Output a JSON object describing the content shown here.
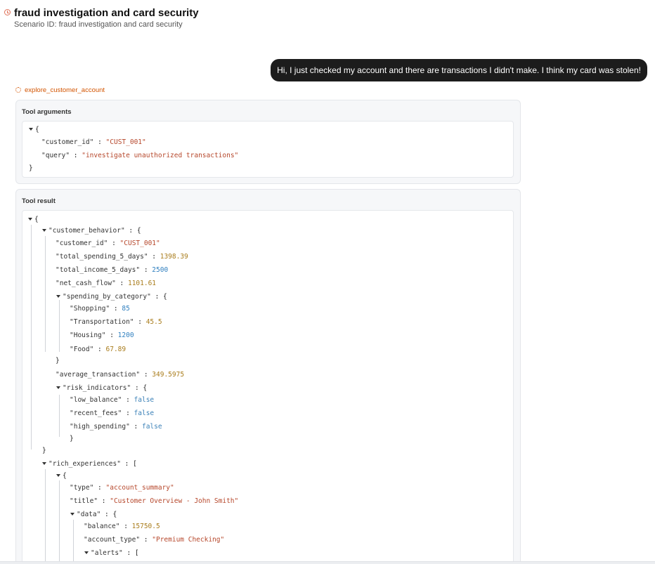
{
  "header": {
    "title": "fraud investigation and card security",
    "subtitle": "Scenario ID: fraud investigation and card security",
    "icon": "clock-icon"
  },
  "user_message": "Hi, I just checked my account and there are transactions I didn't make. I think my card was stolen!",
  "tool_call": {
    "name": "explore_customer_account",
    "icon": "gear-icon"
  },
  "tool_arguments": {
    "label": "Tool arguments",
    "customer_id_key": "\"customer_id\"",
    "customer_id": "\"CUST_001\"",
    "query_key": "\"query\"",
    "query": "\"investigate unauthorized transactions\""
  },
  "tool_result": {
    "label": "Tool result",
    "customer_behavior": {
      "key": "\"customer_behavior\"",
      "customer_id": {
        "key": "\"customer_id\"",
        "value": "\"CUST_001\""
      },
      "total_spending_5_days": {
        "key": "\"total_spending_5_days\"",
        "value": "1398.39"
      },
      "total_income_5_days": {
        "key": "\"total_income_5_days\"",
        "value": "2500"
      },
      "net_cash_flow": {
        "key": "\"net_cash_flow\"",
        "value": "1101.61"
      },
      "spending_by_category": {
        "key": "\"spending_by_category\"",
        "shopping": {
          "key": "\"Shopping\"",
          "value": "85"
        },
        "transportation": {
          "key": "\"Transportation\"",
          "value": "45.5"
        },
        "housing": {
          "key": "\"Housing\"",
          "value": "1200"
        },
        "food": {
          "key": "\"Food\"",
          "value": "67.89"
        }
      },
      "average_transaction": {
        "key": "\"average_transaction\"",
        "value": "349.5975"
      },
      "risk_indicators": {
        "key": "\"risk_indicators\"",
        "low_balance": {
          "key": "\"low_balance\"",
          "value": "false"
        },
        "recent_fees": {
          "key": "\"recent_fees\"",
          "value": "false"
        },
        "high_spending": {
          "key": "\"high_spending\"",
          "value": "false"
        }
      }
    },
    "rich_experiences": {
      "key": "\"rich_experiences\"",
      "type": {
        "key": "\"type\"",
        "value": "\"account_summary\""
      },
      "title": {
        "key": "\"title\"",
        "value": "\"Customer Overview - John Smith\""
      },
      "data": {
        "key": "\"data\"",
        "balance": {
          "key": "\"balance\"",
          "value": "15750.5"
        },
        "account_type": {
          "key": "\"account_type\"",
          "value": "\"Premium Checking\""
        },
        "alerts": {
          "key": "\"alerts\""
        }
      }
    }
  }
}
